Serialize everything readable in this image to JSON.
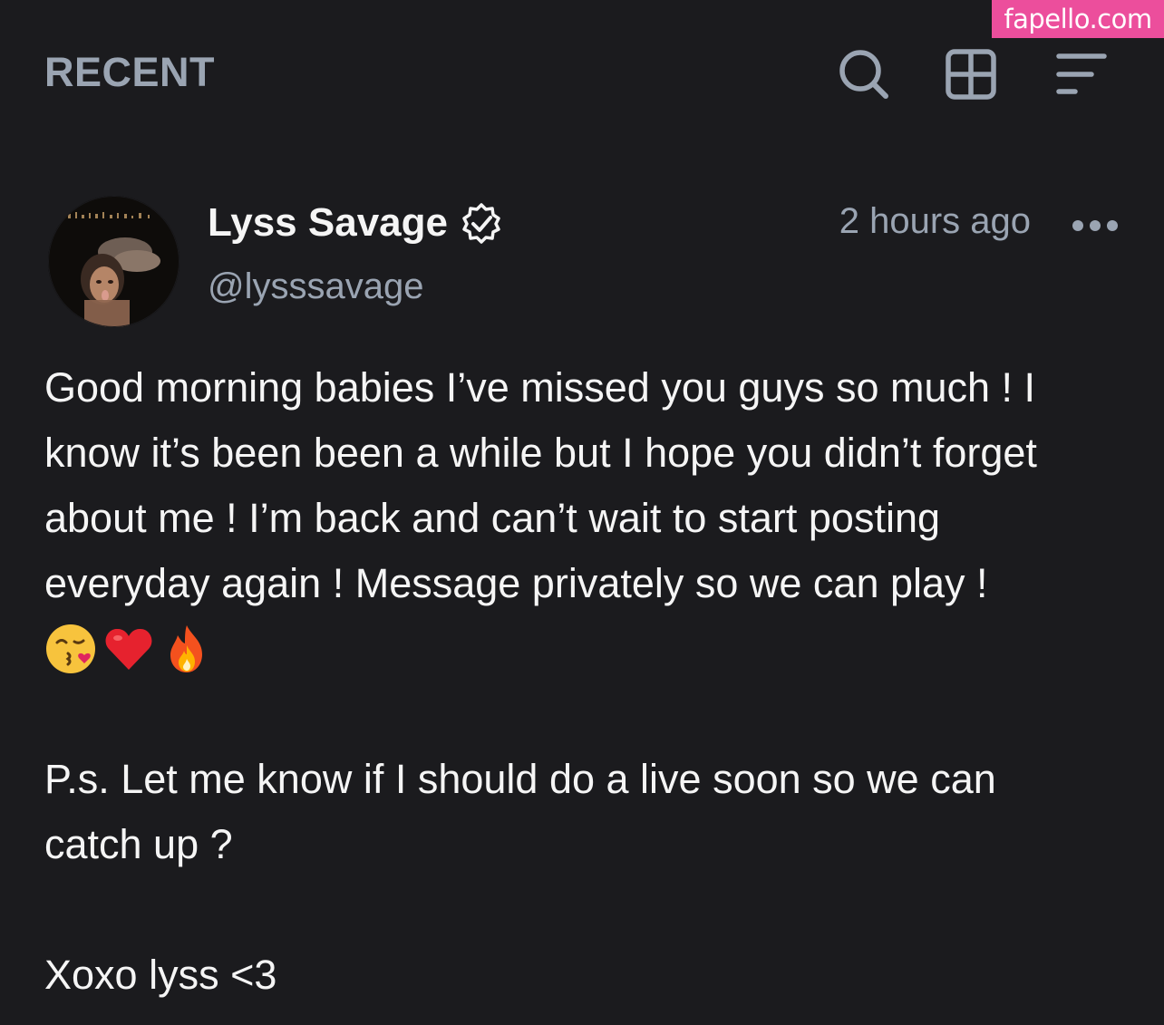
{
  "watermark": "fapello.com",
  "header": {
    "title": "RECENT",
    "icons": [
      "search-icon",
      "grid-icon",
      "sort-icon"
    ]
  },
  "post": {
    "author": {
      "name": "Lyss Savage",
      "handle": "@lysssavage",
      "verified": true
    },
    "timestamp": "2 hours ago",
    "body": {
      "p1_lines": [
        "Good morning babies I’ve missed you guys so much ! I",
        "know it’s been been a while but I hope you didn’t forget",
        "about me ! I’m back and can’t wait to start posting",
        "everyday again ! Message privately so we can play !"
      ],
      "emojis": [
        "😘",
        "❤️",
        "🔥"
      ],
      "p2_lines": [
        "P.s. Let me know if I should do a live soon so we can",
        "catch up ?"
      ],
      "signoff": "Xoxo lyss <3"
    }
  },
  "colors": {
    "background": "#1b1b1e",
    "muted": "#9aa4b2",
    "text": "#f5f5f5",
    "watermark": "#ec4e9c"
  }
}
